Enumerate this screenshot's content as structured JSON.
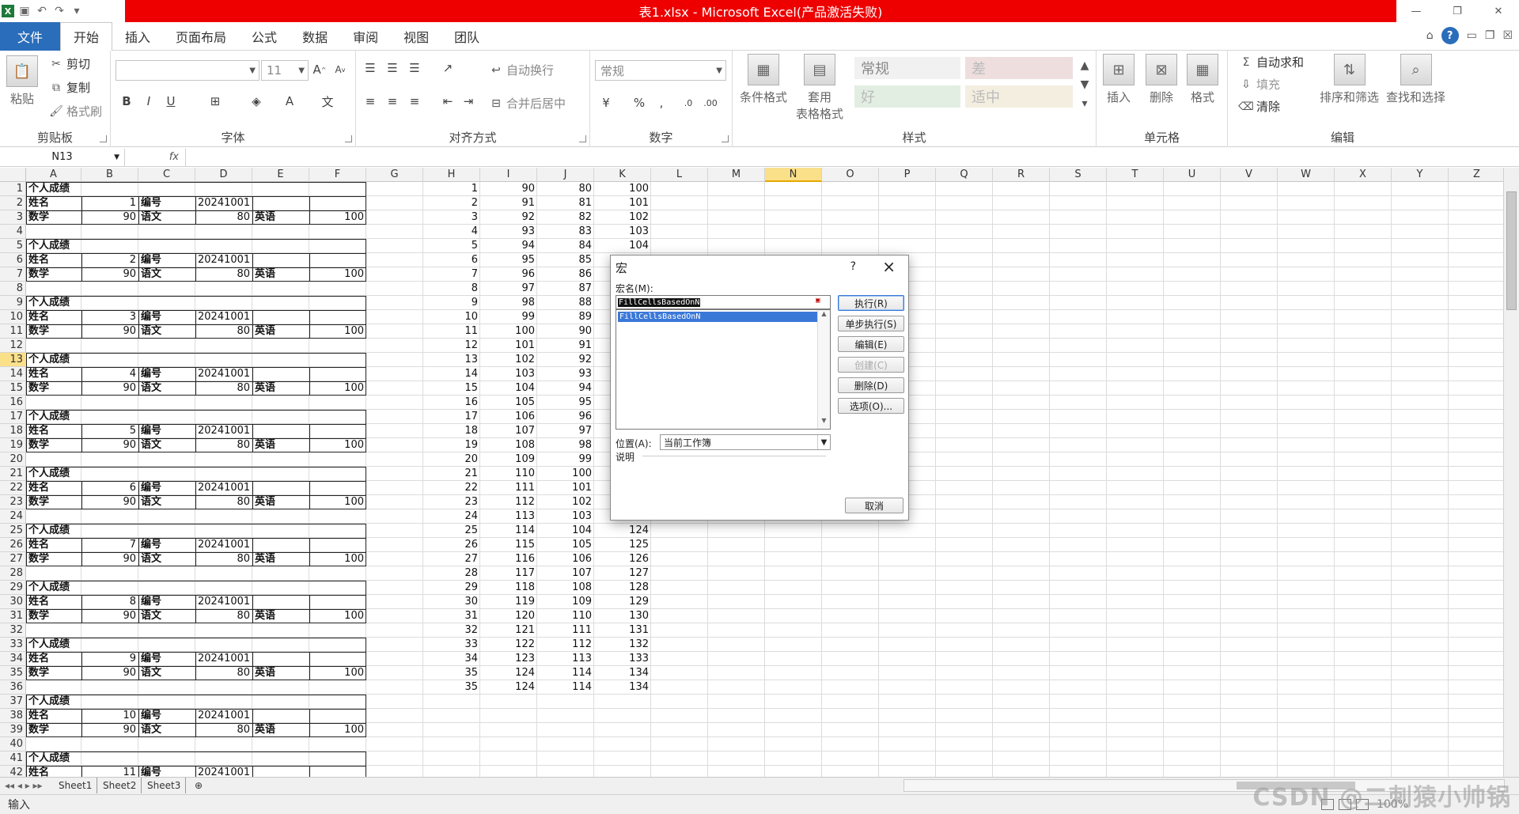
{
  "window": {
    "title": "表1.xlsx  -  Microsoft Excel(产品激活失败)",
    "app_icon": "X"
  },
  "qat": {
    "customize": "▾"
  },
  "tabs": [
    "文件",
    "开始",
    "插入",
    "页面布局",
    "公式",
    "数据",
    "审阅",
    "视图",
    "团队"
  ],
  "ribbon": {
    "clipboard": {
      "title": "剪贴板",
      "paste": "粘贴",
      "cut": "剪切",
      "copy": "复制",
      "format_painter": "格式刷"
    },
    "font": {
      "title": "字体",
      "size": "11",
      "bold": "B",
      "italic": "I",
      "underline": "U"
    },
    "alignment": {
      "title": "对齐方式",
      "wrap": "自动换行",
      "merge": "合并后居中"
    },
    "number": {
      "title": "数字",
      "format": "常规",
      "percent": "%",
      "comma": ","
    },
    "styles": {
      "title": "样式",
      "conditional": "条件格式",
      "table_format": "套用\n表格格式",
      "normal": "常规",
      "bad": "差",
      "good": "好",
      "neutral": "适中"
    },
    "cells": {
      "title": "单元格",
      "insert": "插入",
      "delete": "删除",
      "format": "格式"
    },
    "editing": {
      "title": "编辑",
      "autosum": "自动求和",
      "fill": "填充",
      "clear": "清除",
      "sort": "排序和筛选",
      "find": "查找和选择"
    }
  },
  "formula_bar": {
    "name_box": "N13",
    "fx": "fx",
    "value": ""
  },
  "columns": [
    "A",
    "B",
    "C",
    "D",
    "E",
    "F",
    "G",
    "H",
    "I",
    "J",
    "K",
    "L",
    "M",
    "N",
    "O",
    "P",
    "Q",
    "R",
    "S",
    "T",
    "U",
    "V",
    "W",
    "X",
    "Y",
    "Z"
  ],
  "selected_column": "N",
  "selected_row": "13",
  "rows": [
    "1",
    "2",
    "3",
    "4",
    "5",
    "6",
    "7",
    "8",
    "9",
    "10",
    "11",
    "12",
    "13",
    "14",
    "15",
    "16",
    "17",
    "18",
    "19",
    "20",
    "21",
    "22",
    "23",
    "24",
    "25",
    "26",
    "27",
    "28",
    "29",
    "30",
    "31",
    "32",
    "33",
    "34",
    "35",
    "36",
    "37",
    "38",
    "39",
    "40",
    "41",
    "42"
  ],
  "sheet": {
    "block_title": "个人成绩",
    "label_name": "姓名",
    "label_id": "编号",
    "id_value": "20241001",
    "label_math": "数学",
    "label_chinese": "语文",
    "label_english": "英语",
    "math": "90",
    "chinese": "80",
    "english": "100",
    "blocks": [
      "1",
      "2",
      "3",
      "4",
      "5",
      "6",
      "7",
      "8",
      "9",
      "10",
      "11"
    ],
    "h_col": [
      "1",
      "2",
      "3",
      "4",
      "5",
      "6",
      "7",
      "8",
      "9",
      "10",
      "11",
      "12",
      "13",
      "14",
      "15",
      "16",
      "17",
      "18",
      "19",
      "20",
      "21",
      "22",
      "23",
      "24",
      "25",
      "26",
      "27",
      "28",
      "29",
      "30",
      "31",
      "32",
      "33",
      "34",
      "35",
      "35"
    ],
    "i_col": [
      "90",
      "91",
      "92",
      "93",
      "94",
      "95",
      "96",
      "97",
      "98",
      "99",
      "100",
      "101",
      "102",
      "103",
      "104",
      "105",
      "106",
      "107",
      "108",
      "109",
      "110",
      "111",
      "112",
      "113",
      "114",
      "115",
      "116",
      "117",
      "118",
      "119",
      "120",
      "121",
      "122",
      "123",
      "124",
      "124"
    ],
    "j_col": [
      "80",
      "81",
      "82",
      "83",
      "84",
      "85",
      "86",
      "87",
      "88",
      "89",
      "90",
      "91",
      "92",
      "93",
      "94",
      "95",
      "96",
      "97",
      "98",
      "99",
      "100",
      "101",
      "102",
      "103",
      "104",
      "105",
      "106",
      "107",
      "108",
      "109",
      "110",
      "111",
      "112",
      "113",
      "114",
      "114"
    ],
    "k_col": [
      "100",
      "101",
      "102",
      "103",
      "104",
      "",
      "",
      "",
      "",
      "",
      "",
      "",
      "",
      "",
      "",
      "",
      "",
      "",
      "",
      "",
      "",
      "",
      "",
      "",
      "124",
      "125",
      "126",
      "127",
      "128",
      "129",
      "130",
      "131",
      "132",
      "133",
      "134",
      "134"
    ]
  },
  "sheet_tabs": [
    "Sheet1",
    "Sheet2",
    "Sheet3"
  ],
  "status": {
    "mode": "输入",
    "zoom": "100%"
  },
  "watermark": "CSDN @二刺猿小帅锅",
  "dialog": {
    "title": "宏",
    "help": "?",
    "close": "×",
    "name_label": "宏名(M):",
    "name_value": "FillCellsBasedOnN",
    "list": [
      "FillCellsBasedOnN"
    ],
    "buttons": {
      "run": "执行(R)",
      "step": "单步执行(S)",
      "edit": "编辑(E)",
      "create": "创建(C)",
      "delete": "删除(D)",
      "options": "选项(O)...",
      "cancel": "取消"
    },
    "location_label": "位置(A):",
    "location_value": "当前工作簿",
    "description_label": "说明"
  }
}
